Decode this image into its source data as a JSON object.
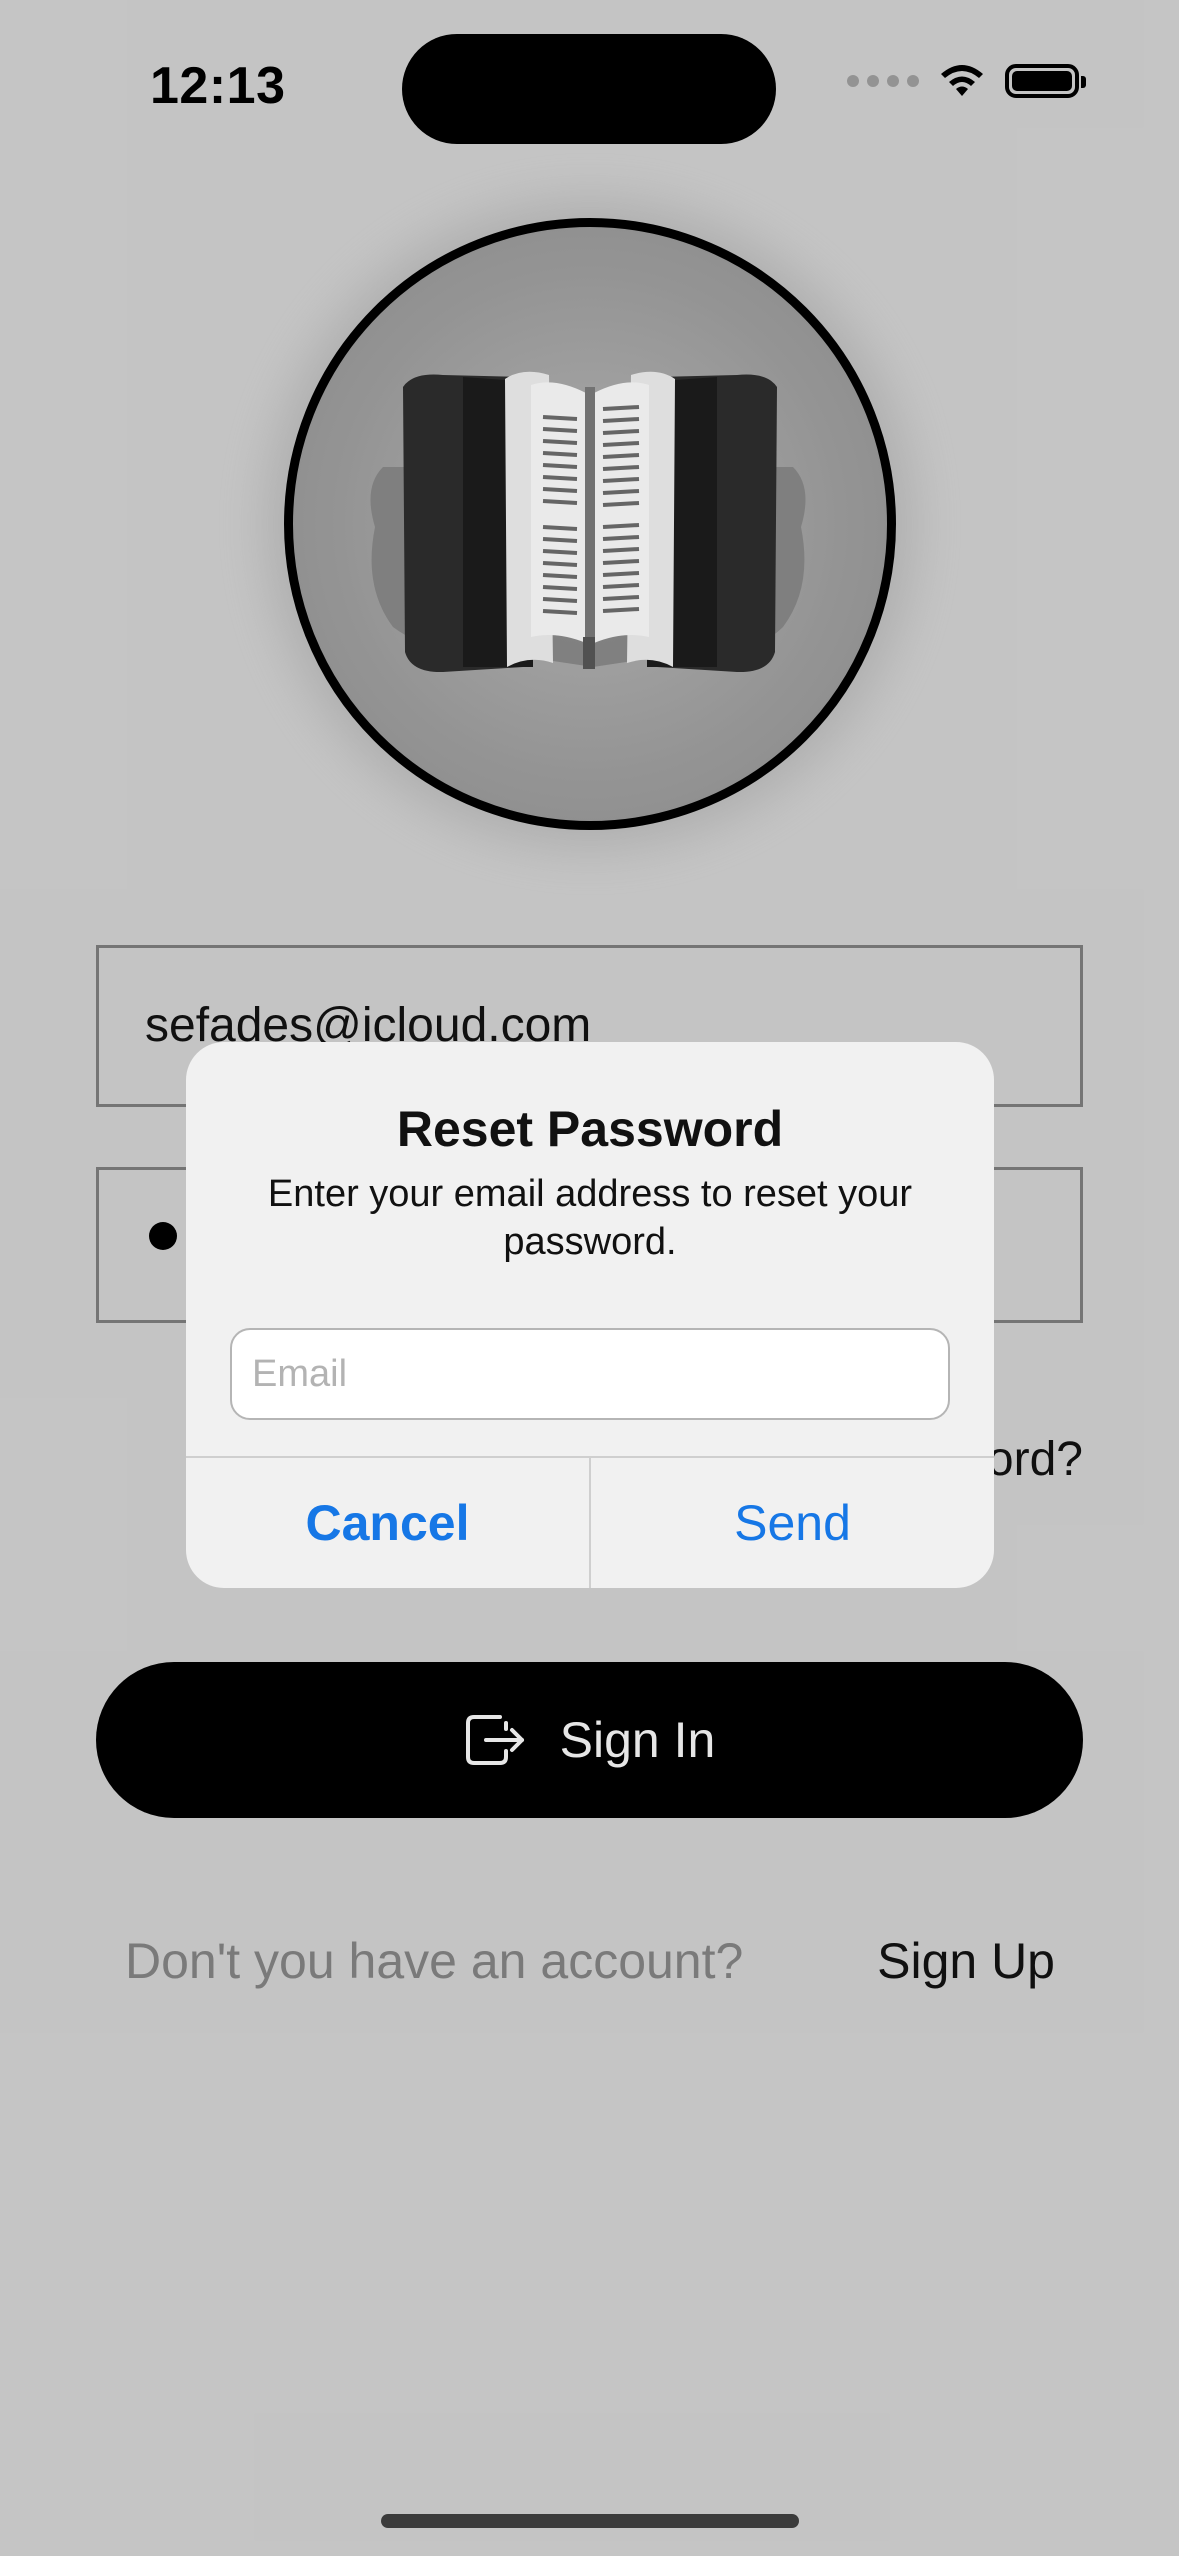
{
  "status_bar": {
    "time": "12:13"
  },
  "login_form": {
    "email_value": "sefades@icloud.com",
    "forgot_password_visible_text": "ord?"
  },
  "sign_in_button": {
    "label": "Sign In",
    "icon": "sign-in-icon"
  },
  "signup_prompt": {
    "question": "Don't you have an account?",
    "link_label": "Sign Up"
  },
  "reset_alert": {
    "title": "Reset Password",
    "message": "Enter your email address to reset your password.",
    "email_placeholder": "Email",
    "cancel_label": "Cancel",
    "send_label": "Send"
  },
  "colors": {
    "background": "#cdcdcd",
    "accent": "#1677e6",
    "button_bg": "#000000",
    "alert_bg": "#f1f1f1"
  },
  "logo": {
    "icon": "open-book-icon"
  }
}
